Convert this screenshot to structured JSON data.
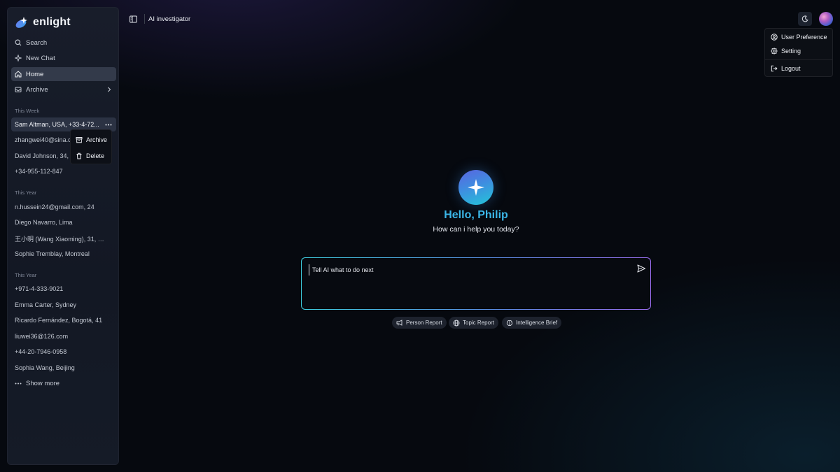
{
  "brand": {
    "name": "enlight"
  },
  "nav": {
    "search": "Search",
    "new_chat": "New Chat",
    "home": "Home",
    "archive": "Archive"
  },
  "sections": {
    "this_week": "This Week",
    "this_year_1": "This Year",
    "this_year_2": "This Year"
  },
  "history": {
    "this_week": [
      "Sam Altman, USA, +33-4-72...",
      "zhangwei40@sina.com",
      "David Johnson, 34, London",
      "+34-955-112-847"
    ],
    "this_year_1": [
      "n.hussein24@gmail.com, 24",
      "Diego Navarro, Lima",
      "王小明 (Wang Xiaoming), 31, Sh...",
      "Sophie Tremblay, Montreal"
    ],
    "this_year_2": [
      "+971-4-333-9021",
      "Emma Carter, Sydney",
      "Ricardo Fernández, Bogotá, 41",
      "liuwei36@126.com",
      "+44-20-7946-0958",
      "Sophia Wang, Beijing"
    ]
  },
  "show_more": "Show more",
  "context_menu": {
    "archive": "Archive",
    "delete": "Delete"
  },
  "header": {
    "title": "AI investigator"
  },
  "user_menu": {
    "preference": "User Preference",
    "setting": "Setting",
    "logout": "Logout"
  },
  "main": {
    "greeting": "Hello, Philip",
    "subtitle": "How can i help you today?",
    "prompt_placeholder": "Tell AI what to do next",
    "chips": [
      "Person Report",
      "Topic Report",
      "Intelligence Brief"
    ]
  },
  "colors": {
    "accent": "#3bb6e8",
    "sidebar_bg": "#161b27",
    "page_bg": "#06090f"
  }
}
